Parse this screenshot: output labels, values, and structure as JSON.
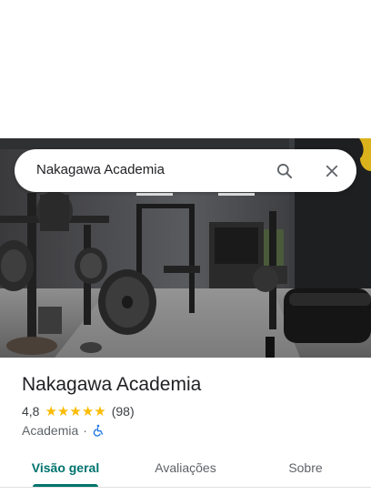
{
  "search": {
    "query": "Nakagawa Academia",
    "search_icon": "search-icon",
    "close_icon": "close-icon"
  },
  "place": {
    "name": "Nakagawa Academia",
    "rating": "4,8",
    "stars": 5,
    "reviews": "(98)",
    "category": "Academia",
    "separator": "·",
    "accessibility_icon": "wheelchair-icon"
  },
  "tabs": [
    {
      "label": "Visão geral",
      "selected": true
    },
    {
      "label": "Avaliações",
      "selected": false
    },
    {
      "label": "Sobre",
      "selected": false
    }
  ],
  "colors": {
    "accent": "#00736e",
    "star": "#fbbc04",
    "accessibility": "#1a73e8"
  }
}
